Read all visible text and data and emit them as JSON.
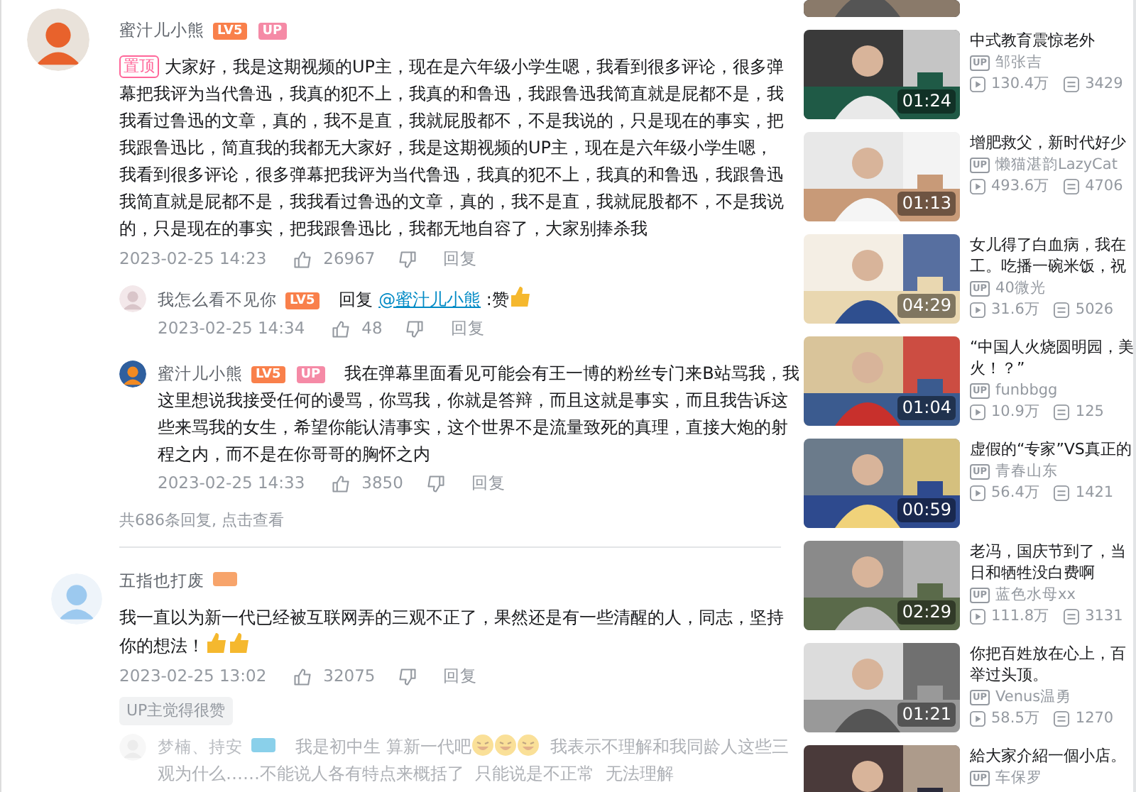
{
  "comments": [
    {
      "user": "蜜汁儿小熊",
      "level": "LV5",
      "up_badge": "UP",
      "pinned_label": "置顶",
      "content": [
        {
          "kind": "text",
          "text": "大家好，我是这期视频的UP主，现在是六年级小学生嗯，我看到很多评论，很多弹幕把我评为当代鲁迅，我真的犯不上，我真的和鲁迅，我跟鲁迅我简直就是屁都不是，我我看过鲁迅的文章，真的，我不是直，我就屁股都不，不是我说的，只是现在的事实，把我跟鲁迅比，简直我的我都无大家好，我是这期视频的UP主，现在是六年级小学生嗯，我看到很多评论，很多弹幕把我评为当代鲁迅，我真的犯不上，我真的和鲁迅，我跟鲁迅我简直就是屁都不是，我我看过鲁迅的文章，真的，我不是直，我就屁股都不，不是我说的，只是现在的事实，把我跟鲁迅比，我都无地自容了，大家别捧杀我"
        }
      ],
      "time": "2023-02-25 14:23",
      "likes": "26967",
      "reply_label": "回复",
      "replies": [
        {
          "user": "我怎么看不见你",
          "level": "LV5",
          "content": [
            {
              "kind": "text",
              "text": "回复 "
            },
            {
              "kind": "mention",
              "text": "@蜜汁儿小熊"
            },
            {
              "kind": "text",
              "text": " :赞"
            },
            {
              "kind": "thumb"
            }
          ],
          "time": "2023-02-25 14:34",
          "likes": "48",
          "reply_label": "回复",
          "faded": false
        },
        {
          "user": "蜜汁儿小熊",
          "level": "LV5",
          "up_badge": "UP",
          "content": [
            {
              "kind": "text",
              "text": "我在弹幕里面看见可能会有王一博的粉丝专门来B站骂我，我这里想说我接受任何的谩骂，你骂我，你就是答辩，而且这就是事实，而且我告诉这些来骂我的女生，希望你能认清事实，这个世界不是流量致死的真理，直接大炮的射程之内，而不是在你哥哥的胸怀之内"
            }
          ],
          "time": "2023-02-25 14:33",
          "likes": "3850",
          "reply_label": "回复",
          "faded": false
        }
      ],
      "replies_summary": "共686条回复, 点击查看"
    },
    {
      "user": "五指也打废",
      "level_badge": {
        "color": "#f7a46b"
      },
      "content": [
        {
          "kind": "text",
          "text": "我一直以为新一代已经被互联网弄的三观不正了，果然还是有一些清醒的人，同志，坚持你的想法！"
        },
        {
          "kind": "thumb"
        },
        {
          "kind": "thumb"
        }
      ],
      "time": "2023-02-25 13:02",
      "likes": "32075",
      "reply_label": "回复",
      "tag": "UP主觉得很赞",
      "replies": [
        {
          "user": "梦楠、持安",
          "level_badge": {
            "color": "#8ad0ea"
          },
          "content": [
            {
              "kind": "text",
              "text": "我是初中生  算新一代吧"
            },
            {
              "kind": "laugh"
            },
            {
              "kind": "laugh"
            },
            {
              "kind": "laugh"
            },
            {
              "kind": "text",
              "text": "  我表示不理解和我同龄人这些三观为什么……不能说人各有特点来概括了  只能说是不正常  无法理解"
            }
          ],
          "faded": true
        }
      ]
    }
  ],
  "videos": [
    {
      "partial": true
    },
    {
      "title": "中式教育震惊老外",
      "up_tag": "UP",
      "uploader": "邹张吉",
      "views": "130.4万",
      "danmaku": "3429",
      "duration": "01:24"
    },
    {
      "title": "增肥救父，新时代好少",
      "up_tag": "UP",
      "uploader": "懒猫湛韵LazyCat",
      "views": "493.6万",
      "danmaku": "4706",
      "duration": "01:13"
    },
    {
      "title": "女儿得了白血病，我在工。吃播一碗米饭，祝",
      "up_tag": "UP",
      "uploader": "40微光",
      "views": "31.6万",
      "danmaku": "5026",
      "duration": "04:29"
    },
    {
      "title": "“中国人火烧圆明园，美火！？”",
      "up_tag": "UP",
      "uploader": "funbbgg",
      "views": "10.9万",
      "danmaku": "125",
      "duration": "01:04"
    },
    {
      "title": "虚假的“专家”VS真正的",
      "up_tag": "UP",
      "uploader": "青春山东",
      "views": "56.4万",
      "danmaku": "1421",
      "duration": "00:59"
    },
    {
      "title": "老冯，国庆节到了，当日和牺牲没白费啊",
      "up_tag": "UP",
      "uploader": "蓝色水母xx",
      "views": "111.8万",
      "danmaku": "3131",
      "duration": "02:29"
    },
    {
      "title": "你把百姓放在心上，百举过头顶。",
      "up_tag": "UP",
      "uploader": "Venus温勇",
      "views": "58.5万",
      "danmaku": "1270",
      "duration": "01:21"
    },
    {
      "title": "給大家介紹一個小店。",
      "up_tag": "UP",
      "uploader": "车保罗"
    }
  ]
}
